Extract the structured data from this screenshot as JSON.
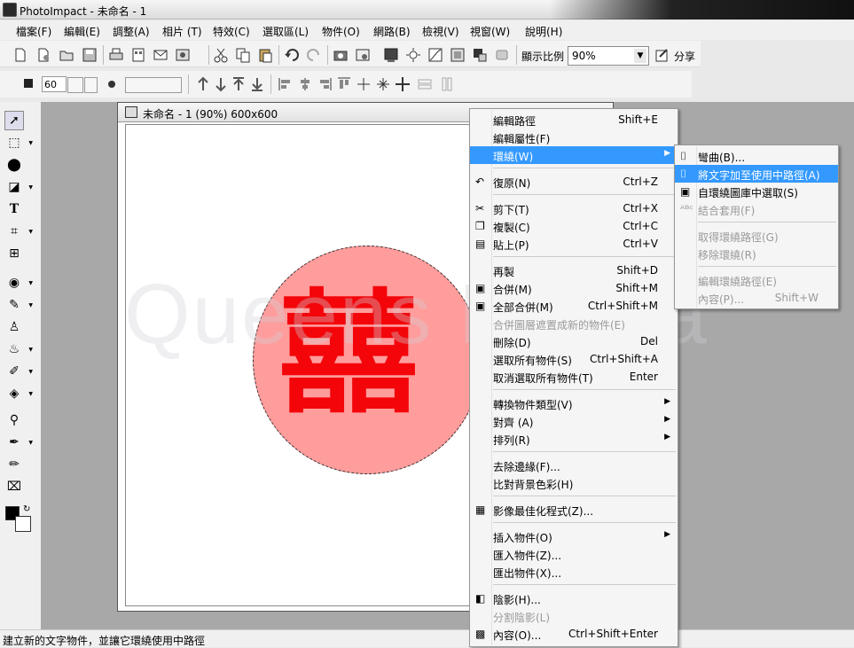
{
  "window": {
    "title": "PhotoImpact - 未命名 - 1"
  },
  "menubar": [
    "檔案(F)",
    "編輯(E)",
    "調整(A)",
    "相片 (T)",
    "特效(C)",
    "選取區(L)",
    "物件(O)",
    "網路(B)",
    "檢視(V)",
    "視窗(W)",
    "說明(H)"
  ],
  "toolbar": {
    "zoom_label": "顯示比例",
    "zoom_value": "90%",
    "share_label": "分享",
    "size_value": "60"
  },
  "document": {
    "title": "未命名 - 1 (90%) 600x600",
    "glyph": "囍",
    "watermark": "Queens Rakka"
  },
  "context_menu": {
    "items": [
      {
        "label": "編輯路徑",
        "shortcut": "Shift+E"
      },
      {
        "label": "編輯屬性(F)",
        "shortcut": ""
      },
      {
        "label": "環繞(W)",
        "shortcut": ""
      },
      {
        "label": "復原(N)",
        "shortcut": "Ctrl+Z"
      },
      {
        "label": "剪下(T)",
        "shortcut": "Ctrl+X"
      },
      {
        "label": "複製(C)",
        "shortcut": "Ctrl+C"
      },
      {
        "label": "貼上(P)",
        "shortcut": "Ctrl+V"
      },
      {
        "label": "再製",
        "shortcut": "Shift+D"
      },
      {
        "label": "合併(M)",
        "shortcut": "Shift+M"
      },
      {
        "label": "全部合併(M)",
        "shortcut": "Ctrl+Shift+M"
      },
      {
        "label": "合併圖層遮置成新的物件(E)",
        "shortcut": ""
      },
      {
        "label": "刪除(D)",
        "shortcut": "Del"
      },
      {
        "label": "選取所有物件(S)",
        "shortcut": "Ctrl+Shift+A"
      },
      {
        "label": "取消選取所有物件(T)",
        "shortcut": "Enter"
      },
      {
        "label": "轉換物件類型(V)",
        "shortcut": ""
      },
      {
        "label": "對齊 (A)",
        "shortcut": ""
      },
      {
        "label": "排列(R)",
        "shortcut": ""
      },
      {
        "label": "去除邊緣(F)...",
        "shortcut": ""
      },
      {
        "label": "比對背景色彩(H)",
        "shortcut": ""
      },
      {
        "label": "影像最佳化程式(Z)...",
        "shortcut": ""
      },
      {
        "label": "插入物件(O)",
        "shortcut": ""
      },
      {
        "label": "匯入物件(Z)...",
        "shortcut": ""
      },
      {
        "label": "匯出物件(X)...",
        "shortcut": ""
      },
      {
        "label": "陰影(H)...",
        "shortcut": ""
      },
      {
        "label": "分割陰影(L)",
        "shortcut": ""
      },
      {
        "label": "內容(O)...",
        "shortcut": "Ctrl+Shift+Enter"
      }
    ]
  },
  "submenu": {
    "items": [
      {
        "label": "彎曲(B)...",
        "shortcut": ""
      },
      {
        "label": "將文字加至使用中路徑(A)",
        "shortcut": ""
      },
      {
        "label": "自環繞圖庫中選取(S)",
        "shortcut": ""
      },
      {
        "label": "結合套用(F)",
        "shortcut": ""
      },
      {
        "label": "取得環繞路徑(G)",
        "shortcut": ""
      },
      {
        "label": "移除環繞(R)",
        "shortcut": ""
      },
      {
        "label": "編輯環繞路徑(E)",
        "shortcut": ""
      },
      {
        "label": "內容(P)...",
        "shortcut": "Shift+W"
      }
    ]
  },
  "status": {
    "text": "建立新的文字物件，並讓它環繞使用中路徑"
  },
  "colors": {
    "highlight": "#3399ff",
    "glyph_red": "#f3050a",
    "circle_pink": "#ff9c9c"
  }
}
